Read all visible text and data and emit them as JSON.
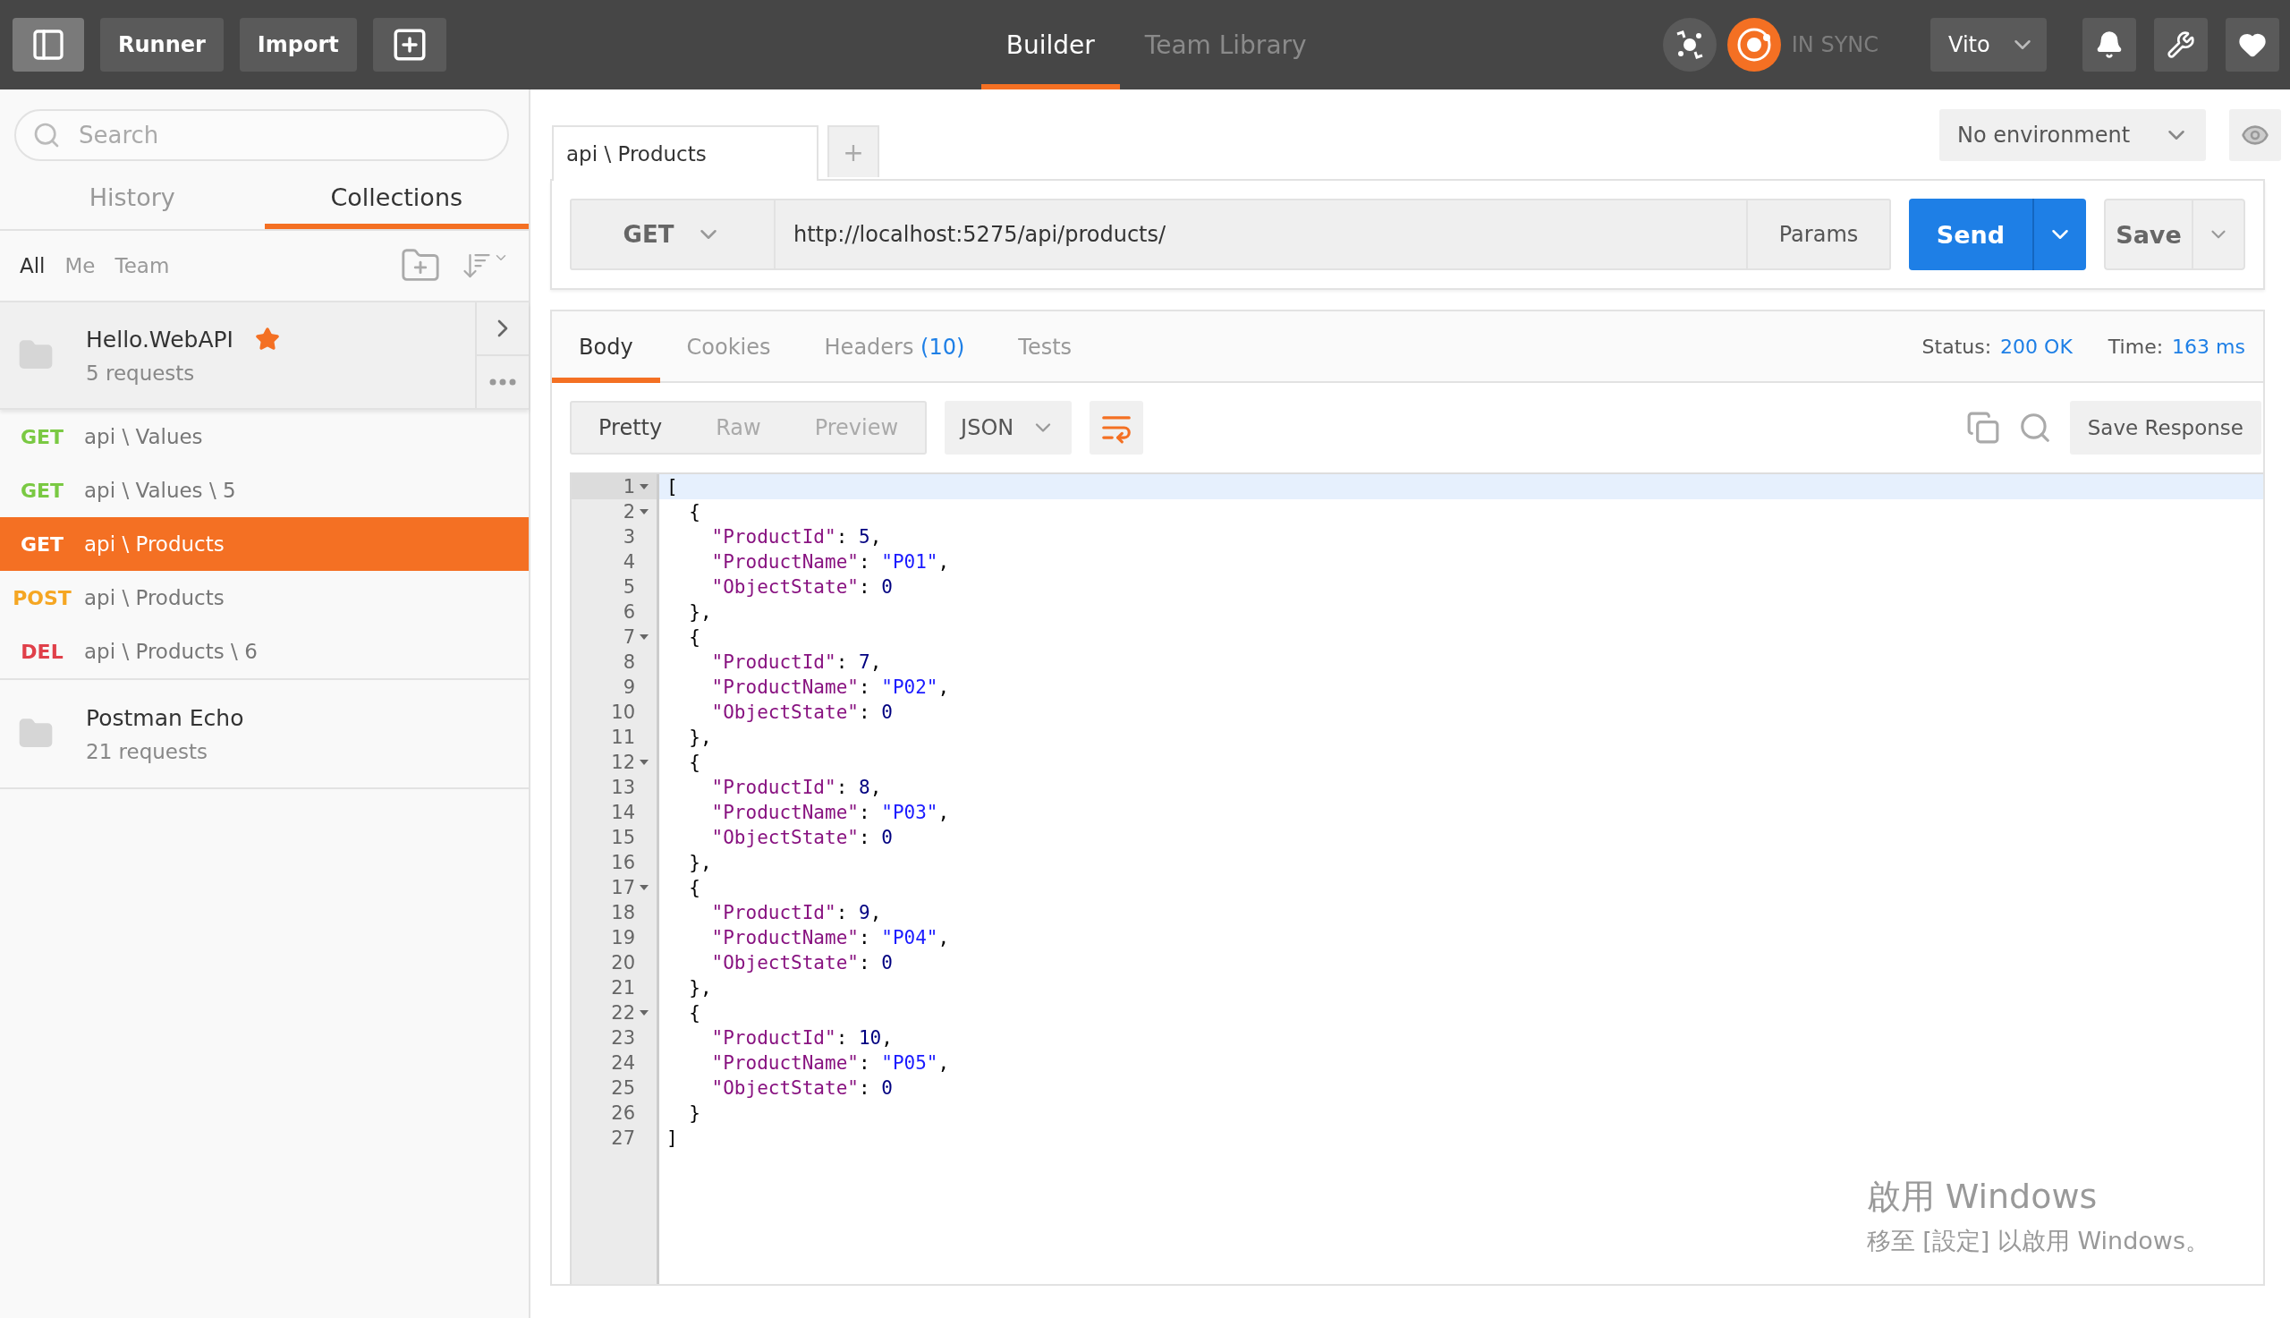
{
  "topbar": {
    "buttons": [
      "Runner",
      "Import"
    ],
    "tabs": [
      {
        "label": "Builder",
        "selected": true
      },
      {
        "label": "Team Library",
        "selected": false
      }
    ],
    "sync": "IN SYNC",
    "user": "Vito"
  },
  "sidebar": {
    "search": {
      "placeholder": "Search"
    },
    "tabs": [
      {
        "label": "History",
        "selected": false
      },
      {
        "label": "Collections",
        "selected": true
      }
    ],
    "filters": [
      {
        "label": "All",
        "selected": true
      },
      {
        "label": "Me",
        "selected": false
      },
      {
        "label": "Team",
        "selected": false
      }
    ],
    "collections": [
      {
        "name": "Hello.WebAPI",
        "count": "5 requests",
        "starred": true,
        "expanded": true,
        "requests": [
          {
            "method": "GET",
            "color": "#7ac943",
            "name": "api \\ Values",
            "selected": false
          },
          {
            "method": "GET",
            "color": "#7ac943",
            "name": "api \\ Values \\ 5",
            "selected": false
          },
          {
            "method": "GET",
            "name": "api \\ Products",
            "selected": true
          },
          {
            "method": "POST",
            "color": "#f5a623",
            "name": "api \\ Products",
            "selected": false
          },
          {
            "method": "DEL",
            "color": "#e0404a",
            "name": "api \\ Products \\ 6",
            "selected": false
          }
        ]
      },
      {
        "name": "Postman Echo",
        "count": "21 requests",
        "starred": false,
        "expanded": false
      }
    ]
  },
  "request_tabs": [
    {
      "label": "api \\ Products",
      "selected": true
    }
  ],
  "add_tab": "+",
  "environment": "No environment",
  "request": {
    "method": "GET",
    "url": "http://localhost:5275/api/products/",
    "params": "Params",
    "send": "Send",
    "save": "Save"
  },
  "response": {
    "tabs": [
      {
        "label": "Body",
        "selected": true
      },
      {
        "label": "Cookies",
        "selected": false
      },
      {
        "label": "Headers",
        "count": "(10)",
        "selected": false
      },
      {
        "label": "Tests",
        "selected": false
      }
    ],
    "status_label": "Status:",
    "status": "200 OK",
    "time_label": "Time:",
    "time": "163 ms",
    "views": [
      {
        "label": "Pretty",
        "selected": true
      },
      {
        "label": "Raw",
        "selected": false
      },
      {
        "label": "Preview",
        "selected": false
      }
    ],
    "format": "JSON",
    "save_response": "Save Response",
    "lines": [
      {
        "n": "1",
        "fold": true,
        "cursor": true,
        "text": "["
      },
      {
        "n": "2",
        "fold": true,
        "text": "  {"
      },
      {
        "n": "3",
        "fold": false,
        "text": "    \"ProductId\": 5,"
      },
      {
        "n": "4",
        "fold": false,
        "text": "    \"ProductName\": \"P01\","
      },
      {
        "n": "5",
        "fold": false,
        "text": "    \"ObjectState\": 0"
      },
      {
        "n": "6",
        "fold": false,
        "text": "  },"
      },
      {
        "n": "7",
        "fold": true,
        "text": "  {"
      },
      {
        "n": "8",
        "fold": false,
        "text": "    \"ProductId\": 7,"
      },
      {
        "n": "9",
        "fold": false,
        "text": "    \"ProductName\": \"P02\","
      },
      {
        "n": "10",
        "fold": false,
        "text": "    \"ObjectState\": 0"
      },
      {
        "n": "11",
        "fold": false,
        "text": "  },"
      },
      {
        "n": "12",
        "fold": true,
        "text": "  {"
      },
      {
        "n": "13",
        "fold": false,
        "text": "    \"ProductId\": 8,"
      },
      {
        "n": "14",
        "fold": false,
        "text": "    \"ProductName\": \"P03\","
      },
      {
        "n": "15",
        "fold": false,
        "text": "    \"ObjectState\": 0"
      },
      {
        "n": "16",
        "fold": false,
        "text": "  },"
      },
      {
        "n": "17",
        "fold": true,
        "text": "  {"
      },
      {
        "n": "18",
        "fold": false,
        "text": "    \"ProductId\": 9,"
      },
      {
        "n": "19",
        "fold": false,
        "text": "    \"ProductName\": \"P04\","
      },
      {
        "n": "20",
        "fold": false,
        "text": "    \"ObjectState\": 0"
      },
      {
        "n": "21",
        "fold": false,
        "text": "  },"
      },
      {
        "n": "22",
        "fold": true,
        "text": "  {"
      },
      {
        "n": "23",
        "fold": false,
        "text": "    \"ProductId\": 10,"
      },
      {
        "n": "24",
        "fold": false,
        "text": "    \"ProductName\": \"P05\","
      },
      {
        "n": "25",
        "fold": false,
        "text": "    \"ObjectState\": 0"
      },
      {
        "n": "26",
        "fold": false,
        "text": "  }"
      },
      {
        "n": "27",
        "fold": false,
        "text": "]"
      }
    ]
  },
  "os_notice": {
    "title": "啟用 Windows",
    "text": "移至 [設定] 以啟用 Windows。"
  }
}
